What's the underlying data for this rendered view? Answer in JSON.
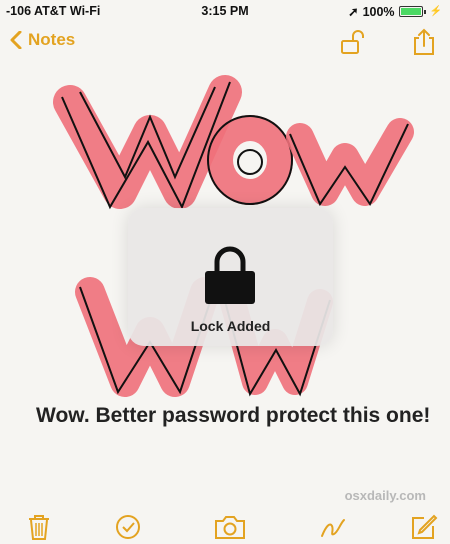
{
  "status_bar": {
    "carrier": "-106 AT&T Wi-Fi",
    "time": "3:15 PM",
    "battery": "100%",
    "battery_level": 1.0
  },
  "nav": {
    "back_label": "Notes",
    "lock_icon": "unlocked-padlock-icon",
    "share_icon": "share-icon"
  },
  "hud": {
    "label": "Lock Added",
    "icon": "locked-padlock-icon"
  },
  "note": {
    "text": "Wow. Better password protect this one!"
  },
  "watermark": "osxdaily.com",
  "toolbar": {
    "icons": [
      "trash-icon",
      "checklist-icon",
      "camera-icon",
      "sketch-icon",
      "compose-icon"
    ]
  },
  "colors": {
    "accent": "#e3a321",
    "sketch_fill": "#f0707a",
    "background": "#f6f5f2"
  }
}
